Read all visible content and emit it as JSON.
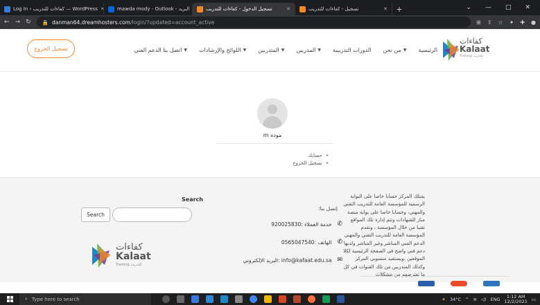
{
  "browser": {
    "tabs": [
      {
        "title": "Log In ‹ كفاءات للتدريب — WordPress",
        "color": "#3a7bd5"
      },
      {
        "title": "mawda mody - Outlook - البريد",
        "color": "#0a64d8"
      },
      {
        "title": "تسجيل الدخول - كفاءات للتدريب",
        "color": "#f08a2b",
        "active": true
      },
      {
        "title": "تسجيل - كفاءات للتدريب",
        "color": "#f08a2b"
      }
    ],
    "new_tab": "+",
    "url_host": "danman64.dreamhosters.com",
    "url_path": "/login/?updated=account_active"
  },
  "site": {
    "logout_label": "تسجيل الخروج",
    "logo_ar": "كفاءات",
    "logo_en": "Kalaat",
    "logo_sub": "Training للتدريب",
    "nav": [
      {
        "label": "الرئيسية",
        "caret": false
      },
      {
        "label": "من نحن",
        "caret": true
      },
      {
        "label": "الدورات التدريبية",
        "caret": false
      },
      {
        "label": "المدربين",
        "caret": true
      },
      {
        "label": "المتدربين",
        "caret": true
      },
      {
        "label": "اللوائح والإرشادات",
        "caret": true
      },
      {
        "label": "اتصل بنا الدعم الفني",
        "caret": true
      }
    ]
  },
  "profile": {
    "username": "m موده",
    "links": [
      "حسابك",
      "تسجيل الخروج"
    ]
  },
  "footer": {
    "about": "يمتلك المركز حسابا خاصا على البوابة الرسمية للمؤسسة العامة للتدريب التقني والمهني، وحسابا خاصا على بوابة منصة منار للشهادات وتتم إدارة تلك المواقع تقنيا من خلال المؤسسة ، وتقدم المؤسسة العامة للتدريب التقني والمهني الدعم الفني المباشر وغير المباشر ولديها دعم فني واضح في الصفحة الرئيسية لكلا الموقعين ،ويستفيد منسوبي المركز وكذلك المتدربين من تلك القنوات في كل ما تعترضهم من مشكلات",
    "contact_title": "إتصل بنا:",
    "customer_service": "خدمة العملاء :920025830",
    "phone": "الهاتف :0565047540",
    "email": "البريد الإلكتروني: info@kafaat.edu.sa",
    "search_title": "Search",
    "search_button": "Search",
    "search_placeholder": ""
  },
  "taskbar": {
    "search_placeholder": "Type here to search",
    "weather": "34°C",
    "lang": "ENG",
    "time": "1:12 AM",
    "date": "12/2/2021"
  },
  "colors": {
    "accent": "#f08a2b",
    "logo_blue": "#1e88c8",
    "logo_green": "#6ab04c",
    "logo_purple": "#6a3d9a"
  }
}
